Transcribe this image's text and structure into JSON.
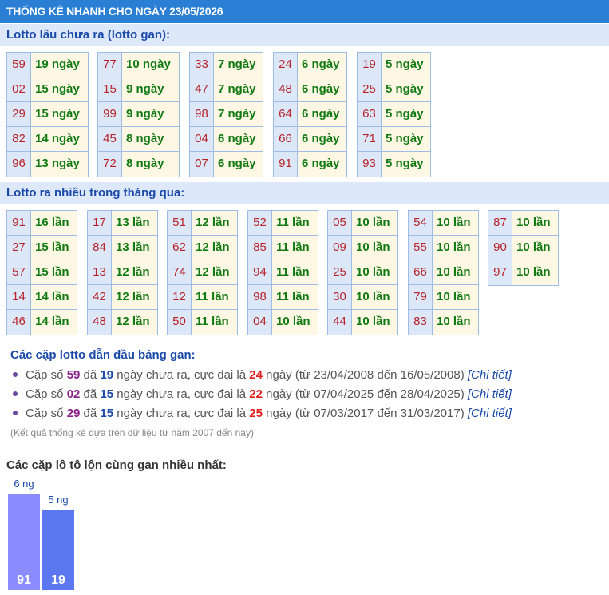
{
  "header": {
    "title": "THỐNG KÊ NHANH CHO NGÀY 23/05/2026"
  },
  "gan_section": {
    "title": "Lotto lâu chưa ra (lotto gan):",
    "groups": [
      [
        {
          "num": "59",
          "count": "19 ngày"
        },
        {
          "num": "02",
          "count": "15 ngày"
        },
        {
          "num": "29",
          "count": "15 ngày"
        },
        {
          "num": "82",
          "count": "14 ngày"
        },
        {
          "num": "96",
          "count": "13 ngày"
        }
      ],
      [
        {
          "num": "77",
          "count": "10 ngày"
        },
        {
          "num": "15",
          "count": "9 ngày"
        },
        {
          "num": "99",
          "count": "9 ngày"
        },
        {
          "num": "45",
          "count": "8 ngày"
        },
        {
          "num": "72",
          "count": "8 ngày"
        }
      ],
      [
        {
          "num": "33",
          "count": "7 ngày"
        },
        {
          "num": "47",
          "count": "7 ngày"
        },
        {
          "num": "98",
          "count": "7 ngày"
        },
        {
          "num": "04",
          "count": "6 ngày"
        },
        {
          "num": "07",
          "count": "6 ngày"
        }
      ],
      [
        {
          "num": "24",
          "count": "6 ngày"
        },
        {
          "num": "48",
          "count": "6 ngày"
        },
        {
          "num": "64",
          "count": "6 ngày"
        },
        {
          "num": "66",
          "count": "6 ngày"
        },
        {
          "num": "91",
          "count": "6 ngày"
        }
      ],
      [
        {
          "num": "19",
          "count": "5 ngày"
        },
        {
          "num": "25",
          "count": "5 ngày"
        },
        {
          "num": "63",
          "count": "5 ngày"
        },
        {
          "num": "71",
          "count": "5 ngày"
        },
        {
          "num": "93",
          "count": "5 ngày"
        }
      ]
    ]
  },
  "frequent_section": {
    "title": "Lotto ra nhiều trong tháng qua:",
    "groups": [
      [
        {
          "num": "91",
          "count": "16 lần"
        },
        {
          "num": "27",
          "count": "15 lần"
        },
        {
          "num": "57",
          "count": "15 lần"
        },
        {
          "num": "14",
          "count": "14 lần"
        },
        {
          "num": "46",
          "count": "14 lần"
        }
      ],
      [
        {
          "num": "17",
          "count": "13 lần"
        },
        {
          "num": "84",
          "count": "13 lần"
        },
        {
          "num": "13",
          "count": "12 lần"
        },
        {
          "num": "42",
          "count": "12 lần"
        },
        {
          "num": "48",
          "count": "12 lần"
        }
      ],
      [
        {
          "num": "51",
          "count": "12 lần"
        },
        {
          "num": "62",
          "count": "12 lần"
        },
        {
          "num": "74",
          "count": "12 lần"
        },
        {
          "num": "12",
          "count": "11 lần"
        },
        {
          "num": "50",
          "count": "11 lần"
        }
      ],
      [
        {
          "num": "52",
          "count": "11 lần"
        },
        {
          "num": "85",
          "count": "11 lần"
        },
        {
          "num": "94",
          "count": "11 lần"
        },
        {
          "num": "98",
          "count": "11 lần"
        },
        {
          "num": "04",
          "count": "10 lần"
        }
      ],
      [
        {
          "num": "05",
          "count": "10 lần"
        },
        {
          "num": "09",
          "count": "10 lần"
        },
        {
          "num": "25",
          "count": "10 lần"
        },
        {
          "num": "30",
          "count": "10 lần"
        },
        {
          "num": "44",
          "count": "10 lần"
        }
      ],
      [
        {
          "num": "54",
          "count": "10 lần"
        },
        {
          "num": "55",
          "count": "10 lần"
        },
        {
          "num": "66",
          "count": "10 lần"
        },
        {
          "num": "79",
          "count": "10 lần"
        },
        {
          "num": "83",
          "count": "10 lần"
        }
      ],
      [
        {
          "num": "87",
          "count": "10 lần"
        },
        {
          "num": "90",
          "count": "10 lần"
        },
        {
          "num": "97",
          "count": "10 lần"
        }
      ]
    ]
  },
  "pairs": {
    "title": "Các cặp lotto dẫn đầu bảng gan:",
    "items": [
      {
        "prefix": "Cặp số ",
        "num": "59",
        "mid1": " đã ",
        "days": "19",
        "mid2": " ngày chưa ra, cực đại là ",
        "max": "24",
        "suffix": " ngày (từ 23/04/2008 đến 16/05/2008) ",
        "link": "[Chi tiết]"
      },
      {
        "prefix": "Cặp số ",
        "num": "02",
        "mid1": " đã ",
        "days": "15",
        "mid2": " ngày chưa ra, cực đại là ",
        "max": "22",
        "suffix": " ngày (từ 07/04/2025 đến 28/04/2025) ",
        "link": "[Chi tiết]"
      },
      {
        "prefix": "Cặp số ",
        "num": "29",
        "mid1": " đã ",
        "days": "15",
        "mid2": " ngày chưa ra, cực đại là ",
        "max": "25",
        "suffix": " ngày (từ 07/03/2017 đến 31/03/2017) ",
        "link": "[Chi tiết]"
      }
    ],
    "note": "(Kết quả thống kê dựa trên dữ liệu từ năm 2007 đến nay)"
  },
  "chart": {
    "title": "Các cặp lô tô lộn cùng gan nhiều nhất:",
    "colors": [
      "#8a8cff",
      "#5b78f0"
    ]
  },
  "chart_data": {
    "type": "bar",
    "categories": [
      "91",
      "19"
    ],
    "values": [
      6,
      5
    ],
    "value_labels": [
      "6 ng",
      "5 ng"
    ],
    "title": "Các cặp lô tô lộn cùng gan nhiều nhất:"
  }
}
